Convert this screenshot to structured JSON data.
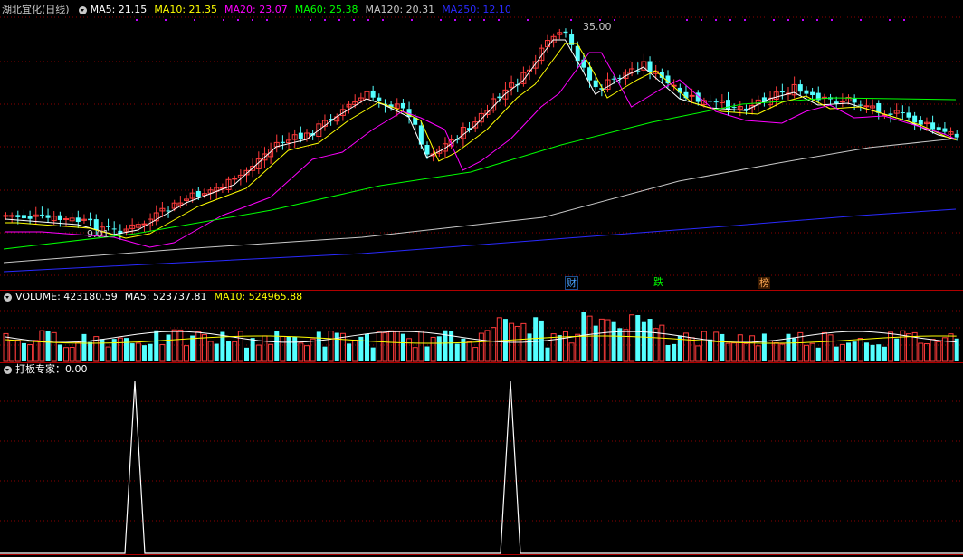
{
  "main_panel": {
    "title": "湖北宜化(日线)",
    "indicators": [
      {
        "label": "MA5: 21.15",
        "color": "#ffffff"
      },
      {
        "label": "MA10: 21.35",
        "color": "#ffff00"
      },
      {
        "label": "MA20: 23.07",
        "color": "#ff00ff"
      },
      {
        "label": "MA60: 25.38",
        "color": "#00ff00"
      },
      {
        "label": "MA120: 20.31",
        "color": "#c8c8c8"
      },
      {
        "label": "MA250: 12.10",
        "color": "#2a2aff"
      }
    ],
    "high_label": "35.00",
    "low_label": "9.01",
    "event_tags": [
      {
        "text": "财",
        "color": "#4aa3ff"
      },
      {
        "text": "跌",
        "color": "#00ff00"
      },
      {
        "text": "榜",
        "color": "#ffaa55"
      }
    ]
  },
  "volume_panel": {
    "indicators": [
      {
        "label": "VOLUME: 423180.59",
        "color": "#ffffff"
      },
      {
        "label": "MA5: 523737.81",
        "color": "#ffffff"
      },
      {
        "label": "MA10: 524965.88",
        "color": "#ffff00"
      }
    ]
  },
  "signal_panel": {
    "indicators": [
      {
        "label": "打板专家：0.00",
        "color": "#ffffff"
      }
    ]
  },
  "colors": {
    "up": "#ff3b3b",
    "down": "#54ffff",
    "grid": "#8b0000",
    "border": "#b00000"
  }
}
